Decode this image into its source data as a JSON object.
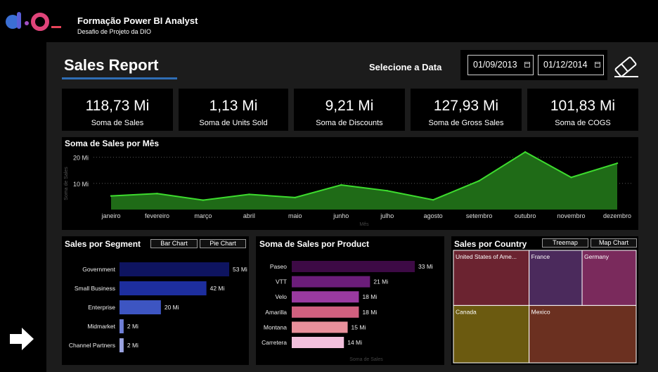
{
  "header": {
    "title": "Formação Power BI Analyst",
    "subtitle": "Desafio de Projeto da DIO",
    "logo_text": "dio"
  },
  "report": {
    "title": "Sales Report",
    "date_label": "Selecione a Data",
    "date_start": "01/09/2013",
    "date_end": "01/12/2014"
  },
  "kpis": [
    {
      "value": "118,73 Mi",
      "label": "Soma de  Sales"
    },
    {
      "value": "1,13 Mi",
      "label": "Soma de Units Sold"
    },
    {
      "value": "9,21 Mi",
      "label": "Soma de Discounts"
    },
    {
      "value": "127,93 Mi",
      "label": "Soma de Gross Sales"
    },
    {
      "value": "101,83 Mi",
      "label": "Soma de COGS"
    }
  ],
  "colors": {
    "background": "#000000",
    "panel": "#1c1c1c",
    "accent": "#2f6db4",
    "line": "#3ddc2e",
    "area": "#1f6b17"
  },
  "chart_data": [
    {
      "type": "area",
      "title": "Soma de Sales por Mês",
      "xlabel": "Mês",
      "ylabel": "Soma de Sales",
      "yticks": [
        "10 Mi",
        "20 Mi"
      ],
      "categories": [
        "janeiro",
        "fevereiro",
        "março",
        "abril",
        "maio",
        "junho",
        "julho",
        "agosto",
        "setembro",
        "outubro",
        "novembro",
        "dezembro"
      ],
      "values": [
        5.2,
        6.1,
        3.6,
        5.8,
        4.6,
        9.4,
        7.2,
        3.7,
        11.0,
        22.0,
        12.3,
        17.7
      ],
      "ylim": [
        0,
        25
      ]
    },
    {
      "type": "bar",
      "title": "Sales por Segment",
      "buttons": [
        "Bar Chart",
        "Pie Chart"
      ],
      "categories": [
        "Government",
        "Small Business",
        "Enterprise",
        "Midmarket",
        "Channel Partners"
      ],
      "values": [
        53,
        42,
        20,
        2,
        2
      ],
      "labels": [
        "53 Mi",
        "42 Mi",
        "20 Mi",
        "2 Mi",
        "2 Mi"
      ],
      "colors": [
        "#0e1460",
        "#1d2e9e",
        "#3d55c2",
        "#6e7ed6",
        "#9aa3e0"
      ]
    },
    {
      "type": "bar",
      "title": "Soma de Sales por Product",
      "xlabel": "Soma de Sales",
      "categories": [
        "Paseo",
        "VTT",
        "Velo",
        "Amarilla",
        "Montana",
        "Carretera"
      ],
      "values": [
        33,
        21,
        18,
        18,
        15,
        14
      ],
      "labels": [
        "33 Mi",
        "21 Mi",
        "18 Mi",
        "18 Mi",
        "15 Mi",
        "14 Mi"
      ],
      "colors": [
        "#3d0a45",
        "#6b1d7a",
        "#9a3aa0",
        "#d0607f",
        "#e8909b",
        "#f2c0dd"
      ]
    },
    {
      "type": "treemap",
      "title": "Sales por Country",
      "buttons": [
        "Treemap",
        "Map Chart"
      ],
      "categories": [
        "United States of America",
        "France",
        "Germany",
        "Canada",
        "Mexico"
      ],
      "display_labels": [
        "United States of Ame...",
        "France",
        "Germany",
        "Canada",
        "Mexico"
      ],
      "colors": [
        "#6b2330",
        "#4b2a5c",
        "#7a2a5c",
        "#6b5a10",
        "#6b3020"
      ]
    }
  ]
}
